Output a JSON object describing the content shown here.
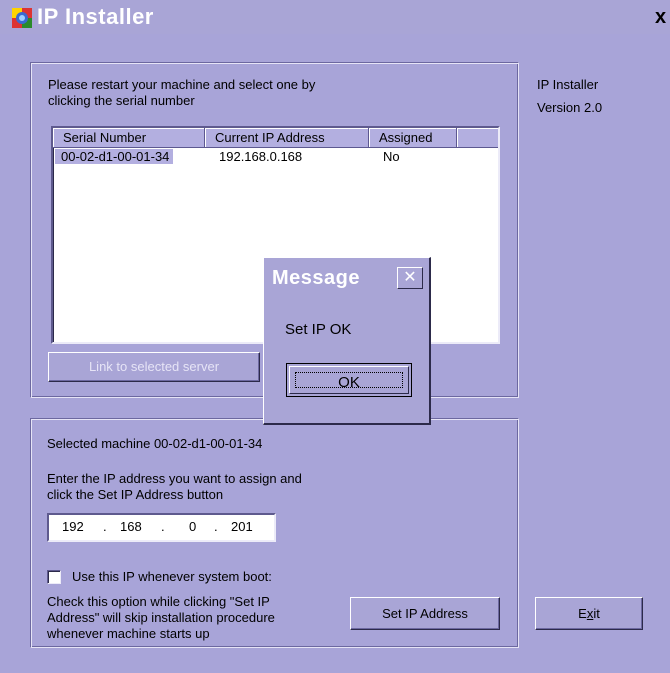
{
  "window": {
    "title": "IP Installer",
    "close_glyph": "x",
    "icon": "web-globe-icon"
  },
  "top_panel": {
    "instruction_line1": "Please restart your machine and select one by",
    "instruction_line2": "clicking the serial number",
    "columns": [
      "Serial Number",
      "Current IP Address",
      "Assigned"
    ],
    "rows": [
      {
        "serial": "00-02-d1-00-01-34",
        "ip": "192.168.0.168",
        "assigned": "No"
      }
    ],
    "link_button": "Link to selected server"
  },
  "side_info": {
    "app_name": "IP Installer",
    "version": "Version 2.0"
  },
  "bottom_panel": {
    "selected_machine": "Selected machine 00-02-d1-00-01-34",
    "enter_line1": "Enter the IP address you want to assign and",
    "enter_line2": "click the Set IP Address button",
    "ip_octets": [
      "192",
      "168",
      "0",
      "201"
    ],
    "ip_dot": ".",
    "checkbox_label": "Use this IP whenever system boot:",
    "checkbox_checked": false,
    "note_line1": "Check this option while clicking \"Set IP",
    "note_line2": "Address\" will skip installation procedure",
    "note_line3": "whenever machine starts up",
    "set_ip_button": "Set IP Address"
  },
  "exit_button": {
    "prefix": "E",
    "accel": "x",
    "suffix": "it"
  },
  "dialog": {
    "title": "Message",
    "close_glyph": "✕",
    "message": "Set IP OK",
    "ok_button": "OK"
  },
  "colors": {
    "window_bg": "#a8a4d8",
    "selection": "#b3afe0",
    "title_text": "#ffffff"
  }
}
